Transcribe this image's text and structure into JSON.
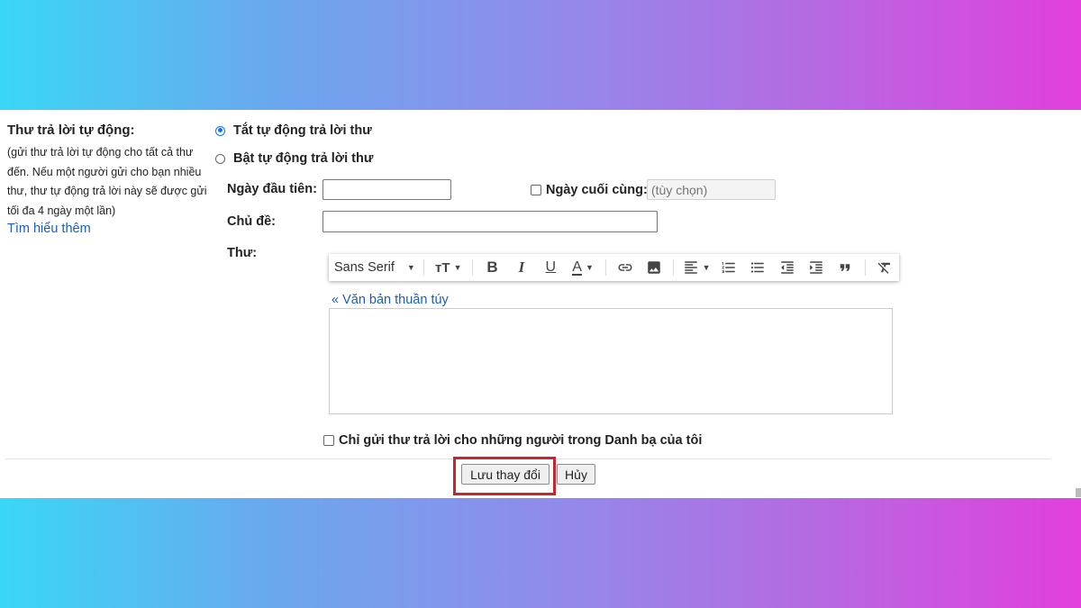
{
  "left": {
    "title": "Thư trả lời tự động:",
    "description": "(gửi thư trả lời tự động cho tất cả thư đến. Nếu một người gửi cho bạn nhiều thư, thư tự động trả lời này sẽ được gửi tối đa 4 ngày một lần)",
    "learn_more": "Tìm hiểu thêm"
  },
  "options": {
    "off_label": "Tắt tự động trả lời thư",
    "on_label": "Bật tự động trả lời thư",
    "selected": "off"
  },
  "fields": {
    "first_day_label": "Ngày đầu tiên:",
    "first_day_value": "",
    "last_day_label": "Ngày cuối cùng:",
    "last_day_placeholder": "(tùy chọn)",
    "subject_label": "Chủ đề:",
    "subject_value": "",
    "message_label": "Thư:"
  },
  "toolbar": {
    "font_name": "Sans Serif",
    "icons": [
      "font-size-icon",
      "bold-icon",
      "italic-icon",
      "underline-icon",
      "text-color-icon",
      "link-icon",
      "image-icon",
      "align-icon",
      "numbered-list-icon",
      "bulleted-list-icon",
      "indent-less-icon",
      "indent-more-icon",
      "quote-icon",
      "remove-formatting-icon"
    ]
  },
  "editor": {
    "plain_text_link": "« Văn bản thuần túy",
    "body": ""
  },
  "contacts_only_label": "Chỉ gửi thư trả lời cho những người trong Danh bạ của tôi",
  "buttons": {
    "save": "Lưu thay đổi",
    "cancel": "Hủy"
  },
  "colors": {
    "link": "#1a5fb4",
    "highlight": "#c6262e",
    "radio_selected": "#1a73e8"
  }
}
